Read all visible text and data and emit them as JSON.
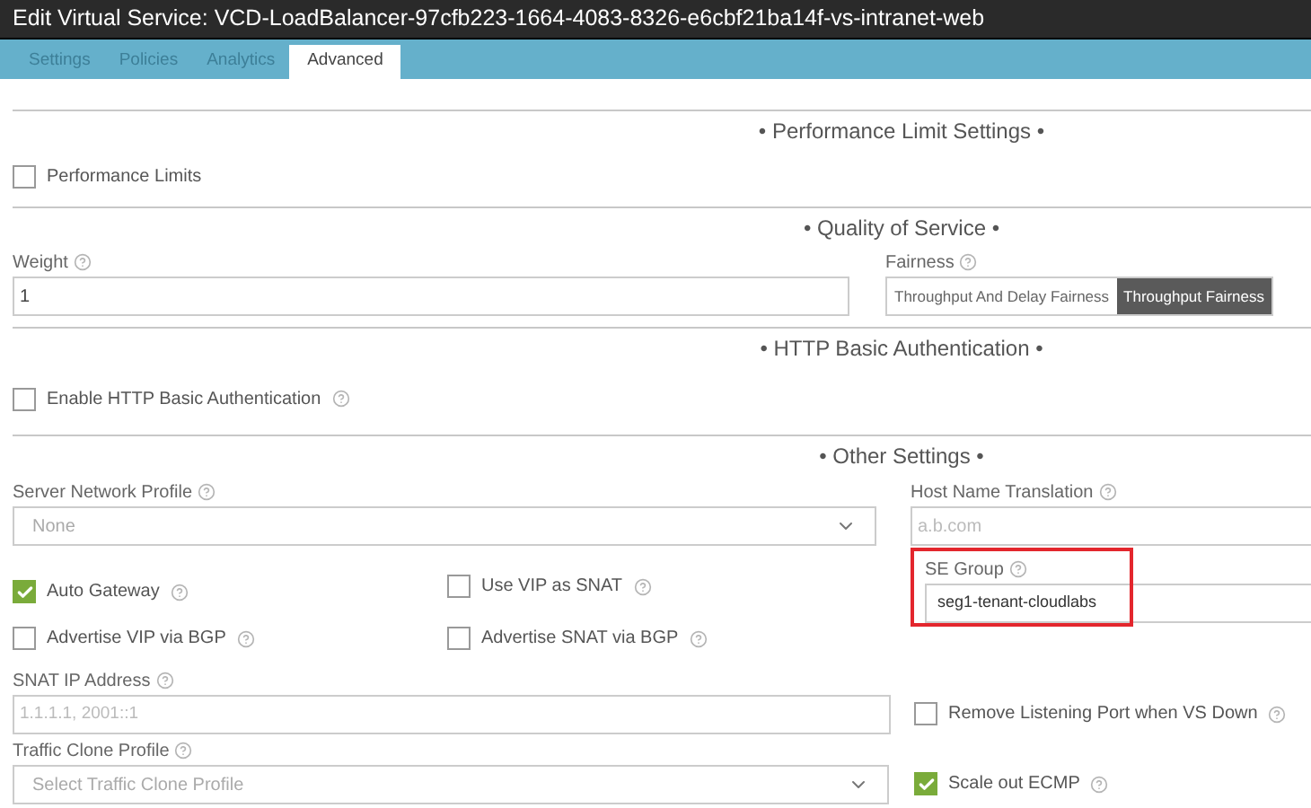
{
  "window": {
    "title": "Edit Virtual Service: VCD-LoadBalancer-97cfb223-1664-4083-8326-e6cbf21ba14f-vs-intranet-web"
  },
  "tabs": [
    {
      "label": "Settings",
      "selected": false
    },
    {
      "label": "Policies",
      "selected": false
    },
    {
      "label": "Analytics",
      "selected": false
    },
    {
      "label": "Advanced",
      "selected": true
    }
  ],
  "performance_limit_settings": {
    "title": "• Performance Limit Settings •",
    "checkbox": {
      "label": "Performance Limits",
      "checked": false,
      "help": false
    }
  },
  "quality_of_service": {
    "title": "• Quality of Service •",
    "weight": {
      "label": "Weight",
      "value": "1"
    },
    "fairness": {
      "label": "Fairness",
      "options": [
        {
          "label": "Throughput And Delay Fairness",
          "selected": false
        },
        {
          "label": "Throughput Fairness",
          "selected": true
        }
      ]
    }
  },
  "http_basic_authentication": {
    "title": "• HTTP Basic Authentication •",
    "checkbox": {
      "label": "Enable HTTP Basic Authentication",
      "checked": false,
      "help": true
    }
  },
  "other_settings": {
    "title": "• Other Settings •",
    "server_network_profile": {
      "label": "Server Network Profile",
      "placeholder": "None"
    },
    "host_name_translation": {
      "label": "Host Name Translation",
      "placeholder": "a.b.com"
    },
    "checkboxes": [
      {
        "label": "Auto Gateway",
        "checked": true,
        "help": true
      },
      {
        "label": "Use VIP as SNAT",
        "checked": false,
        "help": true
      },
      {
        "label": "Advertise VIP via BGP",
        "checked": false,
        "help": true
      },
      {
        "label": "Advertise SNAT via BGP",
        "checked": false,
        "help": true
      }
    ],
    "se_group": {
      "label": "SE Group",
      "value": "seg1-tenant-cloudlabs",
      "highlighted": true
    },
    "snat_ip_address": {
      "label": "SNAT IP Address",
      "placeholder": "1.1.1.1, 2001::1"
    },
    "remove_listening_port": {
      "label": "Remove Listening Port when VS Down",
      "checked": false,
      "help": true
    },
    "traffic_clone_profile": {
      "label": "Traffic Clone Profile",
      "placeholder": "Select Traffic Clone Profile"
    },
    "scale_out_ecmp": {
      "label": "Scale out ECMP",
      "checked": true,
      "help": true
    }
  }
}
